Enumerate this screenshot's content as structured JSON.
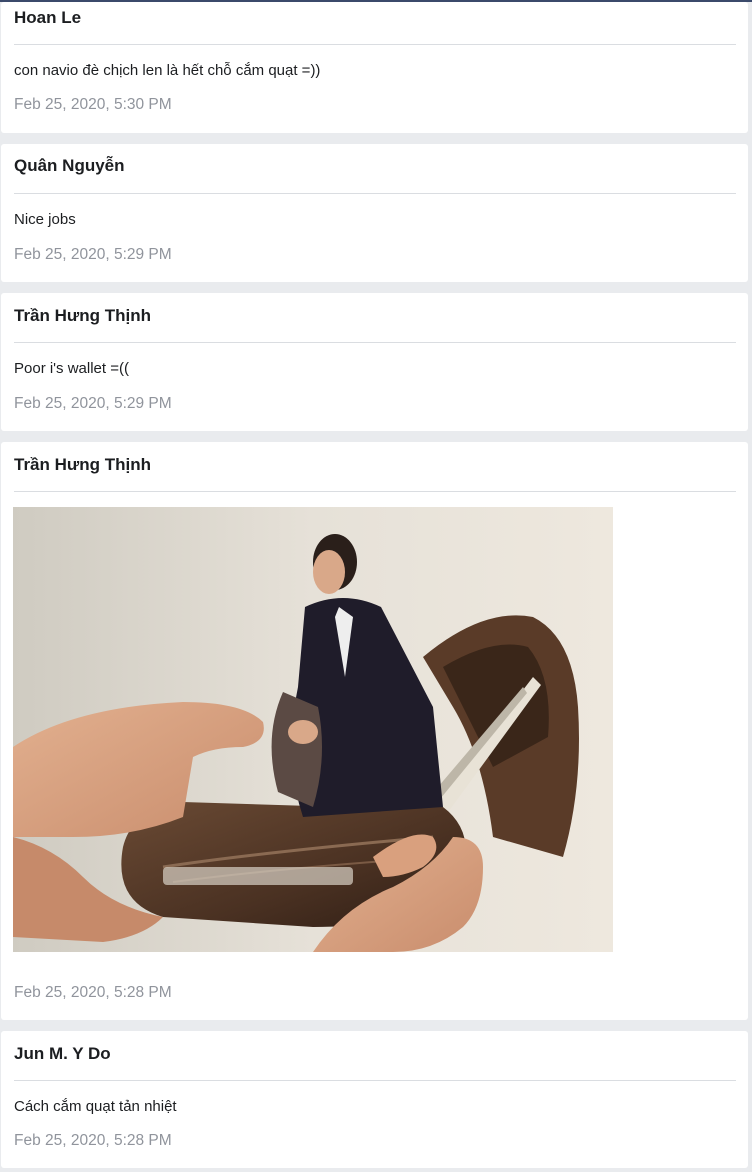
{
  "comments": [
    {
      "author": "Hoan Le",
      "text": "con navio đè chịch len là hết chỗ cắm quạt =))",
      "timestamp": "Feb 25, 2020, 5:30 PM"
    },
    {
      "author": "Quân Nguyễn",
      "text": "Nice jobs",
      "timestamp": "Feb 25, 2020, 5:29 PM"
    },
    {
      "author": "Trần Hưng Thịnh",
      "text": "Poor i's wallet =((",
      "timestamp": "Feb 25, 2020, 5:29 PM"
    },
    {
      "author": "Trần Hưng Thịnh",
      "image": "man-in-empty-wallet-meme",
      "timestamp": "Feb 25, 2020, 5:28 PM"
    },
    {
      "author": "Jun M. Y Do",
      "text": "Cách cắm quạt tản nhiệt",
      "timestamp": "Feb 25, 2020, 5:28 PM"
    }
  ]
}
